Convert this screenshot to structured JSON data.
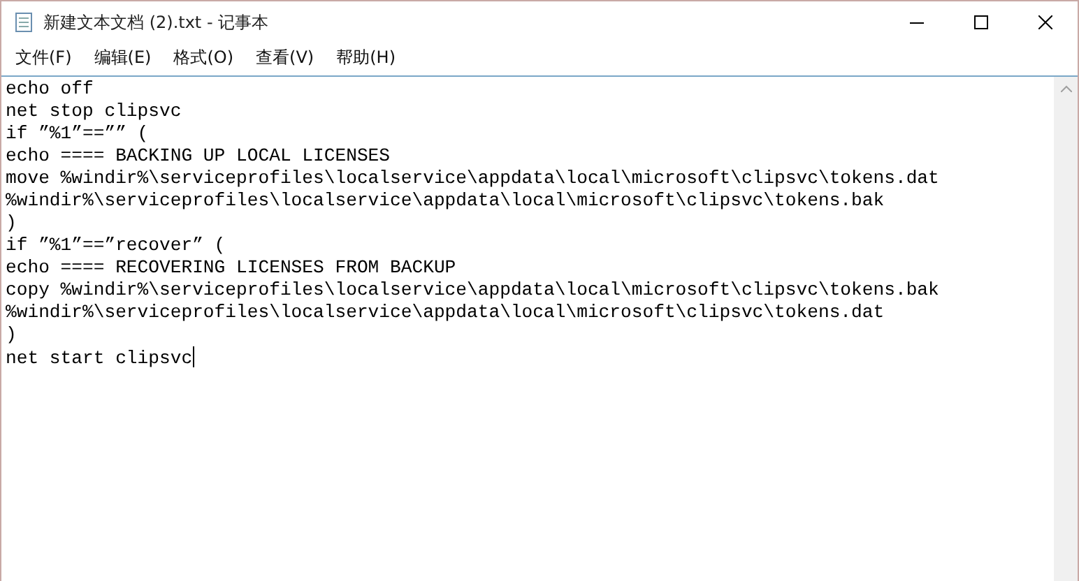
{
  "window": {
    "title": "新建文本文档 (2).txt - 记事本"
  },
  "menu": [
    "文件(F)",
    "编辑(E)",
    "格式(O)",
    "查看(V)",
    "帮助(H)"
  ],
  "editor": {
    "lines": [
      "echo off",
      "net stop clipsvc",
      "if ”%1”==”” (",
      "echo ==== BACKING UP LOCAL LICENSES",
      "move %windir%\\serviceprofiles\\localservice\\appdata\\local\\microsoft\\clipsvc\\tokens.dat",
      "%windir%\\serviceprofiles\\localservice\\appdata\\local\\microsoft\\clipsvc\\tokens.bak",
      ")",
      "if ”%1”==”recover” (",
      "echo ==== RECOVERING LICENSES FROM BACKUP",
      "copy %windir%\\serviceprofiles\\localservice\\appdata\\local\\microsoft\\clipsvc\\tokens.bak",
      "%windir%\\serviceprofiles\\localservice\\appdata\\local\\microsoft\\clipsvc\\tokens.dat",
      ")",
      "net start clipsvc"
    ]
  }
}
